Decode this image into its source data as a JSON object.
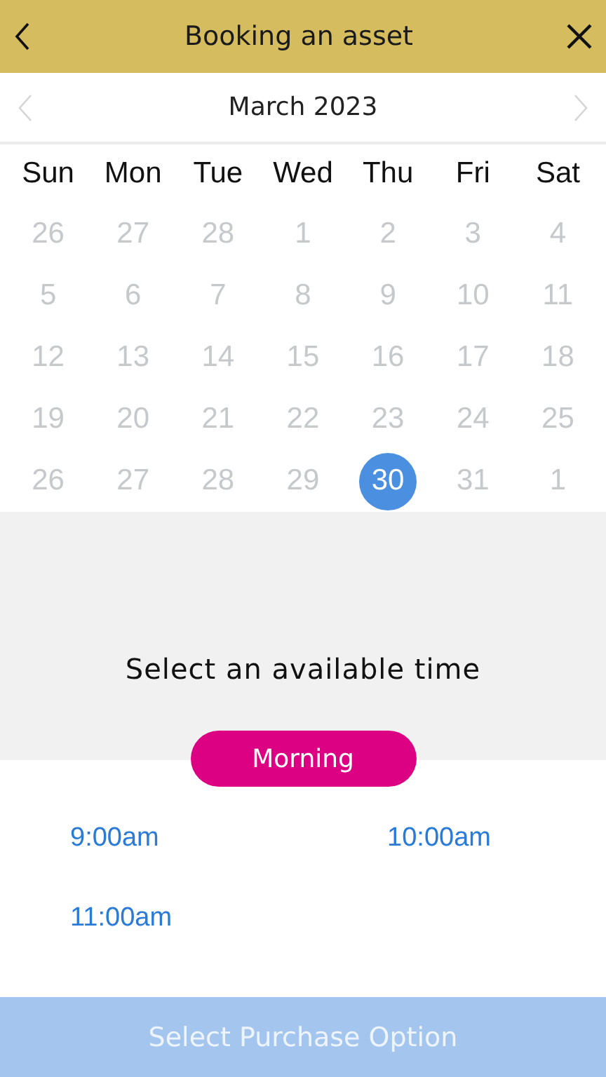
{
  "header": {
    "title": "Booking an asset"
  },
  "calendar": {
    "month": "March 2023",
    "weekdays": [
      "Sun",
      "Mon",
      "Tue",
      "Wed",
      "Thu",
      "Fri",
      "Sat"
    ],
    "weeks": [
      [
        {
          "day": "26",
          "disabled": true,
          "selected": false
        },
        {
          "day": "27",
          "disabled": true,
          "selected": false
        },
        {
          "day": "28",
          "disabled": true,
          "selected": false
        },
        {
          "day": "1",
          "disabled": true,
          "selected": false
        },
        {
          "day": "2",
          "disabled": true,
          "selected": false
        },
        {
          "day": "3",
          "disabled": true,
          "selected": false
        },
        {
          "day": "4",
          "disabled": true,
          "selected": false
        }
      ],
      [
        {
          "day": "5",
          "disabled": true,
          "selected": false
        },
        {
          "day": "6",
          "disabled": true,
          "selected": false
        },
        {
          "day": "7",
          "disabled": true,
          "selected": false
        },
        {
          "day": "8",
          "disabled": true,
          "selected": false
        },
        {
          "day": "9",
          "disabled": true,
          "selected": false
        },
        {
          "day": "10",
          "disabled": true,
          "selected": false
        },
        {
          "day": "11",
          "disabled": true,
          "selected": false
        }
      ],
      [
        {
          "day": "12",
          "disabled": true,
          "selected": false
        },
        {
          "day": "13",
          "disabled": true,
          "selected": false
        },
        {
          "day": "14",
          "disabled": true,
          "selected": false
        },
        {
          "day": "15",
          "disabled": true,
          "selected": false
        },
        {
          "day": "16",
          "disabled": true,
          "selected": false
        },
        {
          "day": "17",
          "disabled": true,
          "selected": false
        },
        {
          "day": "18",
          "disabled": true,
          "selected": false
        }
      ],
      [
        {
          "day": "19",
          "disabled": true,
          "selected": false
        },
        {
          "day": "20",
          "disabled": true,
          "selected": false
        },
        {
          "day": "21",
          "disabled": true,
          "selected": false
        },
        {
          "day": "22",
          "disabled": true,
          "selected": false
        },
        {
          "day": "23",
          "disabled": true,
          "selected": false
        },
        {
          "day": "24",
          "disabled": true,
          "selected": false
        },
        {
          "day": "25",
          "disabled": true,
          "selected": false
        }
      ],
      [
        {
          "day": "26",
          "disabled": true,
          "selected": false
        },
        {
          "day": "27",
          "disabled": true,
          "selected": false
        },
        {
          "day": "28",
          "disabled": true,
          "selected": false
        },
        {
          "day": "29",
          "disabled": true,
          "selected": false
        },
        {
          "day": "30",
          "disabled": false,
          "selected": true
        },
        {
          "day": "31",
          "disabled": true,
          "selected": false
        },
        {
          "day": "1",
          "disabled": true,
          "selected": false
        }
      ]
    ]
  },
  "time_picker": {
    "prompt": "Select an available time",
    "period": "Morning",
    "slots": [
      "9:00am",
      "10:00am",
      "11:00am"
    ]
  },
  "footer_button": {
    "label": "Select Purchase Option",
    "disabled": true
  }
}
